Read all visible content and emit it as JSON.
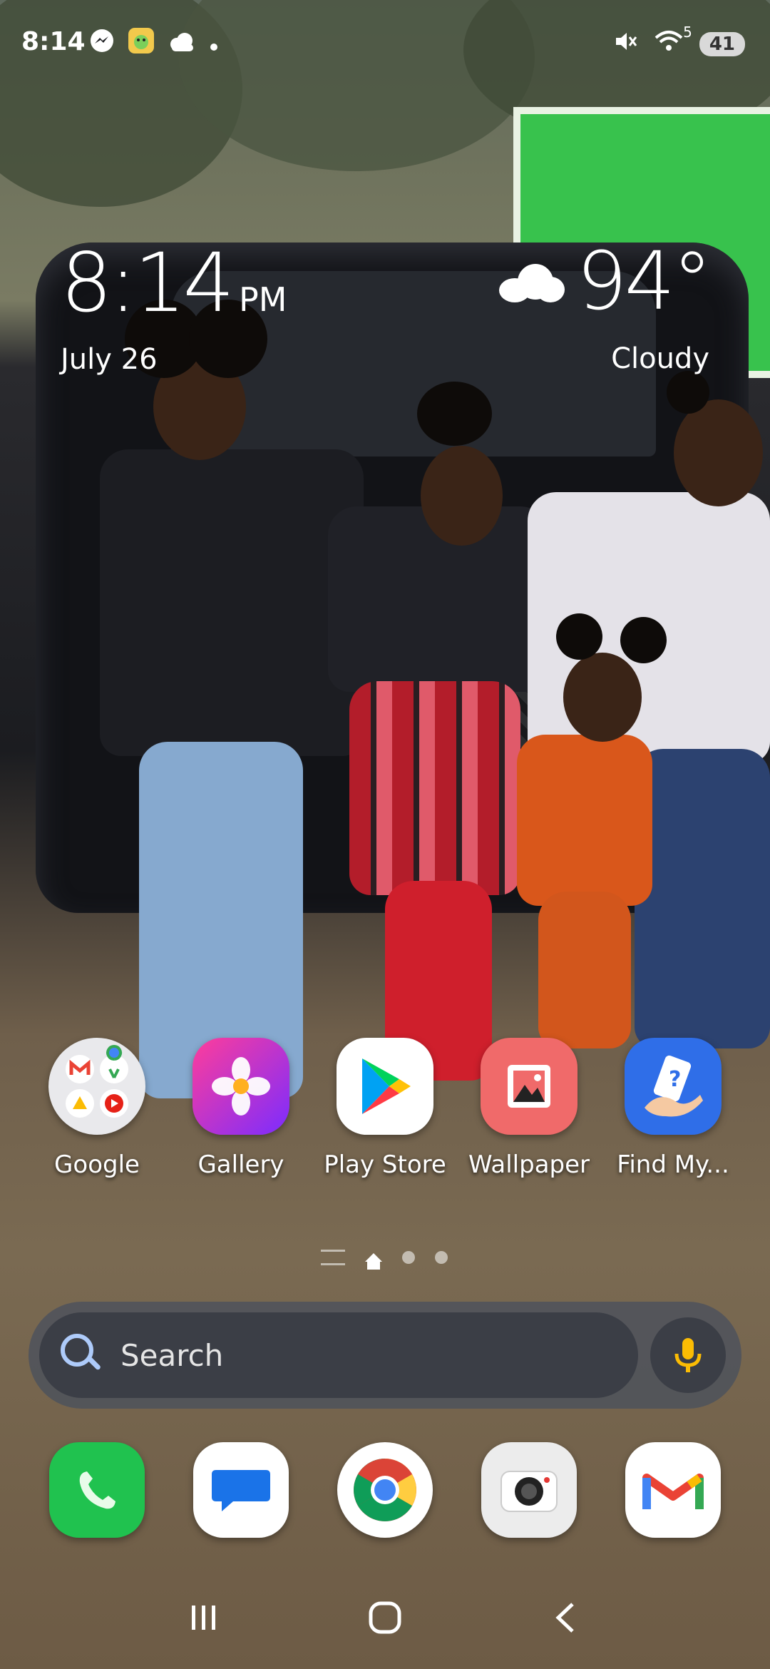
{
  "status_bar": {
    "time": "8:14",
    "notification_icons": [
      "messenger-icon",
      "game-app-icon",
      "cloud-icon",
      "dot-icon"
    ],
    "system_icons": [
      "mute-icon",
      "wifi-icon"
    ],
    "wifi_badge": "5",
    "battery": "41"
  },
  "clock_widget": {
    "time": "8:14",
    "ampm": "PM",
    "date": "July 26"
  },
  "weather_widget": {
    "icon": "cloudy-icon",
    "temperature": "94°",
    "condition": "Cloudy"
  },
  "home_apps": [
    {
      "label": "Google",
      "icon": "google-folder-icon"
    },
    {
      "label": "Gallery",
      "icon": "gallery-icon"
    },
    {
      "label": "Play Store",
      "icon": "play-store-icon"
    },
    {
      "label": "Wallpaper",
      "icon": "wallpaper-icon"
    },
    {
      "label": "Find My...",
      "icon": "find-my-mobile-icon"
    }
  ],
  "pager": {
    "pages": 4,
    "current": "home"
  },
  "search_bar": {
    "placeholder": "Search",
    "icon": "search-icon",
    "mic_icon": "mic-icon"
  },
  "dock": [
    {
      "icon": "phone-icon"
    },
    {
      "icon": "messages-icon"
    },
    {
      "icon": "chrome-icon"
    },
    {
      "icon": "camera-icon"
    },
    {
      "icon": "gmail-icon"
    }
  ],
  "nav_bar": [
    "recents-button",
    "home-button",
    "back-button"
  ],
  "colors": {
    "phone": "#20c24f",
    "messages": "#1a73e8",
    "gallery_start": "#ff3d9a",
    "gallery_end": "#7b2cff",
    "wallpaper": "#f06a6a",
    "mic": "#fbbc04"
  }
}
